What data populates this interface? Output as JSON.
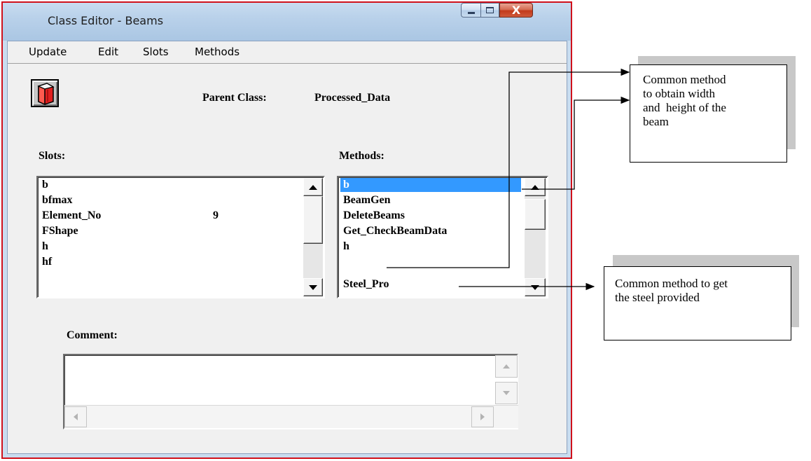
{
  "window": {
    "title": "Class Editor - Beams",
    "close_glyph": "X"
  },
  "menu": {
    "update": "Update",
    "edit": "Edit",
    "slots": "Slots",
    "methods": "Methods"
  },
  "header": {
    "parent_label": "Parent Class:",
    "parent_value": "Processed_Data"
  },
  "slots": {
    "label": "Slots:",
    "items": [
      {
        "name": "b",
        "value": ""
      },
      {
        "name": "bfmax",
        "value": ""
      },
      {
        "name": "Element_No",
        "value": "9"
      },
      {
        "name": "FShape",
        "value": ""
      },
      {
        "name": "h",
        "value": ""
      },
      {
        "name": "hf",
        "value": ""
      }
    ]
  },
  "methods": {
    "label": "Methods:",
    "items": [
      "b",
      "BeamGen",
      "DeleteBeams",
      "Get_CheckBeamData",
      "h",
      "Steel_Pro"
    ],
    "selected": "b"
  },
  "comment": {
    "label": "Comment:",
    "value": ""
  },
  "annotations": {
    "width_height": [
      "Common method",
      "to obtain width",
      "and  height of the",
      "beam"
    ],
    "steel": [
      "Common method to get",
      "the steel provided"
    ]
  },
  "icons": {
    "toolbar": "red-book-icon",
    "min": "minimize-icon",
    "max": "maximize-icon",
    "close": "close-icon"
  },
  "colors": {
    "frame_border": "#d0111b",
    "selection": "#3399ff",
    "close_button": "#c23a1b",
    "book": "#e01f1f"
  }
}
